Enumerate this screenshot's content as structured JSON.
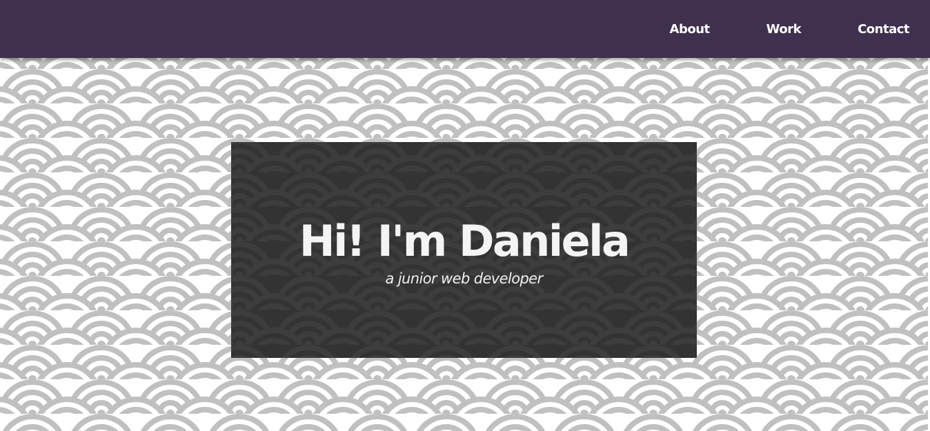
{
  "nav": {
    "items": [
      {
        "label": "About"
      },
      {
        "label": "Work"
      },
      {
        "label": "Contact"
      }
    ]
  },
  "hero": {
    "title": "Hi! I'm Daniela",
    "subtitle": "a junior web developer"
  },
  "colors": {
    "nav_background": "#40304f",
    "pattern_light": "#c0c0c0",
    "pattern_background": "#ffffff",
    "card_background": "#333333",
    "card_pattern": "#3d3d3d",
    "text": "#ffffff"
  }
}
